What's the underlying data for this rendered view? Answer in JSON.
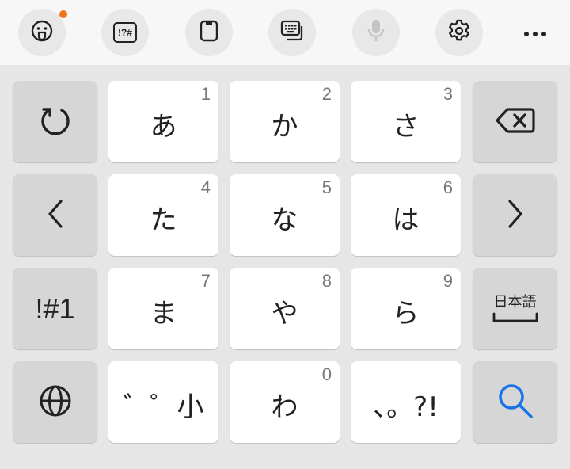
{
  "toolbar": {
    "items": [
      {
        "name": "emoji-button",
        "icon": "emoji-face-icon",
        "badge": true
      },
      {
        "name": "symbol-button",
        "icon": "symbols-icon",
        "label": "!?#"
      },
      {
        "name": "clipboard-button",
        "icon": "clipboard-icon"
      },
      {
        "name": "keyboard-switch-button",
        "icon": "keyboard-icon"
      },
      {
        "name": "voice-input-button",
        "icon": "microphone-icon",
        "disabled": true
      },
      {
        "name": "settings-button",
        "icon": "gear-icon"
      },
      {
        "name": "more-button",
        "icon": "more-dots-icon"
      }
    ],
    "badge_color": "#f5731d"
  },
  "keys": {
    "undo": {
      "icon": "undo-icon"
    },
    "a": {
      "kana": "あ",
      "num": "1"
    },
    "ka": {
      "kana": "か",
      "num": "2"
    },
    "sa": {
      "kana": "さ",
      "num": "3"
    },
    "backspace": {
      "icon": "backspace-icon"
    },
    "left": {
      "icon": "chevron-left-icon"
    },
    "ta": {
      "kana": "た",
      "num": "4"
    },
    "na": {
      "kana": "な",
      "num": "5"
    },
    "ha": {
      "kana": "は",
      "num": "6"
    },
    "right": {
      "icon": "chevron-right-icon"
    },
    "symbols": {
      "label": "!#1"
    },
    "ma": {
      "kana": "ま",
      "num": "7"
    },
    "ya": {
      "kana": "や",
      "num": "8"
    },
    "ra": {
      "kana": "ら",
      "num": "9"
    },
    "space": {
      "label": "日本語",
      "icon": "space-bar-icon"
    },
    "globe": {
      "icon": "globe-icon"
    },
    "dakuten": {
      "label": "゛゜小"
    },
    "wa": {
      "kana": "わ",
      "num": "0"
    },
    "punct": {
      "label": "、。?!"
    },
    "search": {
      "icon": "search-icon",
      "color": "#1a73e8"
    }
  },
  "colors": {
    "toolbar_bg": "#f7f7f7",
    "keyboard_bg": "#e6e6e6",
    "function_key": "#d6d6d6",
    "char_key": "#ffffff"
  }
}
